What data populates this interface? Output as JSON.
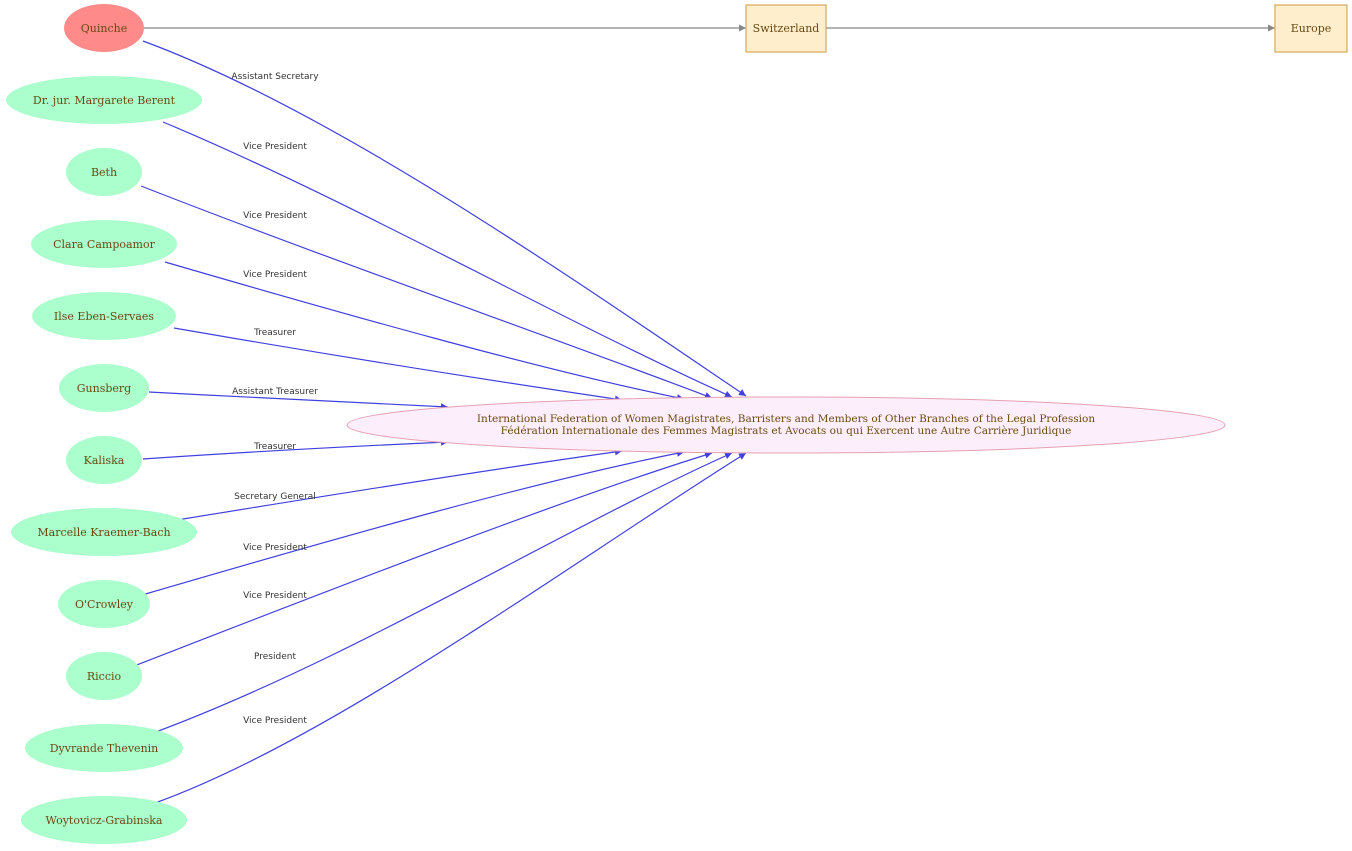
{
  "colors": {
    "person_fill": "#aaffcc",
    "highlight_fill": "#ff8a8a",
    "org_fill": "#fdeefc",
    "org_stroke": "#e5a0b0",
    "place_fill": "#ffeecc",
    "place_stroke": "#d9a85a",
    "role_edge": "#4040e0",
    "location_edge": "#888888",
    "label_text": "#333333",
    "node_text": "#6b4a12"
  },
  "organization": {
    "name_en": "International Federation of Women Magistrates, Barristers and Members of Other Branches of the Legal Profession",
    "name_fr": "Fédération Internationale des Femmes Magistrats et Avocats ou qui Exercent une Autre Carrière Juridique"
  },
  "places": [
    {
      "id": "switzerland",
      "label": "Switzerland"
    },
    {
      "id": "europe",
      "label": "Europe"
    }
  ],
  "people": [
    {
      "id": "quinche",
      "label": "Quinche",
      "role": "Assistant Secretary",
      "highlight": true
    },
    {
      "id": "berent",
      "label": "Dr. jur. Margarete Berent",
      "role": "Vice President",
      "highlight": false
    },
    {
      "id": "beth",
      "label": "Beth",
      "role": "Vice President",
      "highlight": false
    },
    {
      "id": "campoamor",
      "label": "Clara Campoamor",
      "role": "Vice President",
      "highlight": false
    },
    {
      "id": "eben-servaes",
      "label": "Ilse Eben-Servaes",
      "role": "Treasurer",
      "highlight": false
    },
    {
      "id": "gunsberg",
      "label": "Gunsberg",
      "role": "Assistant Treasurer",
      "highlight": false
    },
    {
      "id": "kaliska",
      "label": "Kaliska",
      "role": "Treasurer",
      "highlight": false
    },
    {
      "id": "kraemer-bach",
      "label": "Marcelle Kraemer-Bach",
      "role": "Secretary General",
      "highlight": false
    },
    {
      "id": "ocrowley",
      "label": "O'Crowley",
      "role": "Vice President",
      "highlight": false
    },
    {
      "id": "riccio",
      "label": "Riccio",
      "role": "Vice President",
      "highlight": false
    },
    {
      "id": "thevenin",
      "label": "Dyvrande Thevenin",
      "role": "President",
      "highlight": false
    },
    {
      "id": "woytovicz",
      "label": "Woytovicz-Grabinska",
      "role": "Vice President",
      "highlight": false
    }
  ]
}
